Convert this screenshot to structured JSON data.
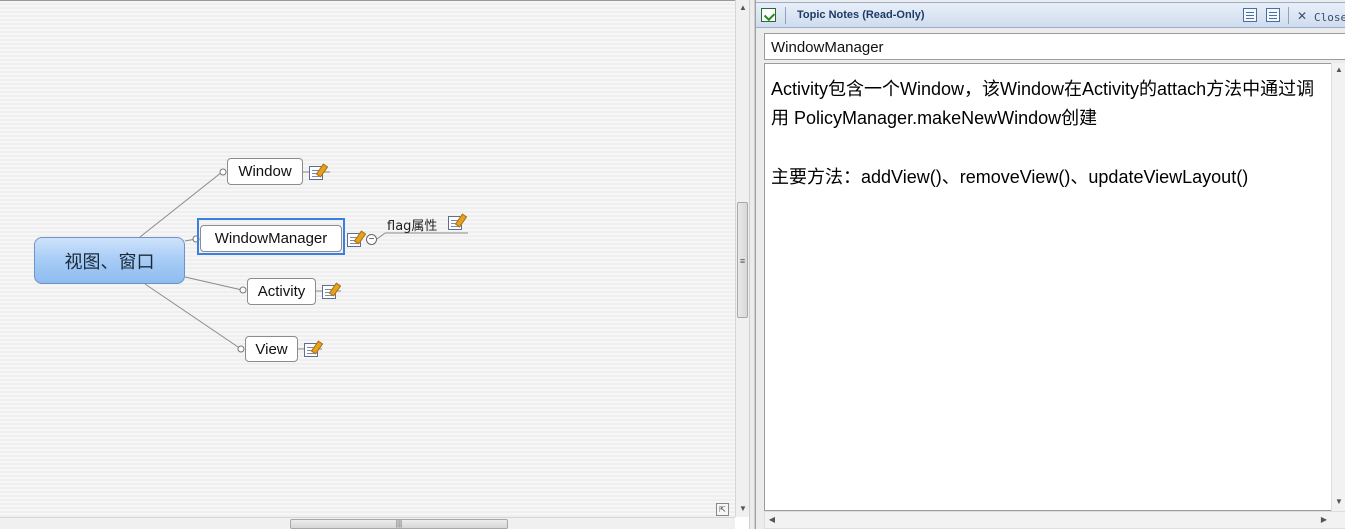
{
  "mindmap": {
    "central_topic": "视图、窗口",
    "topics": [
      {
        "label": "Window"
      },
      {
        "label": "WindowManager",
        "selected": true
      },
      {
        "label": "Activity"
      },
      {
        "label": "View"
      }
    ],
    "subtopic": {
      "label": "flag属性"
    },
    "colors": {
      "central_fill": "#a9cdf6",
      "selection": "#3d7fe0"
    }
  },
  "notes_panel": {
    "title": "Topic Notes (Read-Only)",
    "close_label": "Close",
    "topic_title": "WindowManager",
    "note_paragraphs": [
      "Activity包含一个Window，该Window在Activity的attach方法中通过调用 PolicyManager.makeNewWindow创建",
      "主要方法：addView()、removeView()、updateViewLayout()"
    ]
  }
}
